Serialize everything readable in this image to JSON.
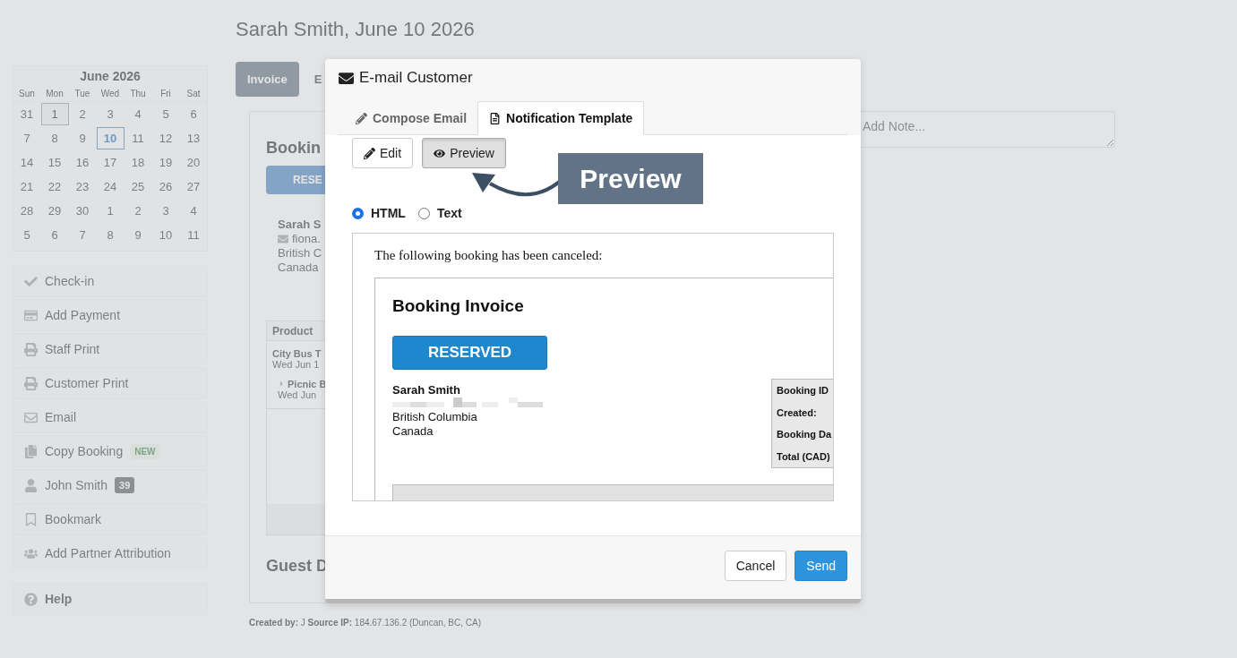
{
  "page": {
    "title": "Sarah Smith, June 10 2026"
  },
  "calendar": {
    "month": "June 2026",
    "weekdays": [
      "Sun",
      "Mon",
      "Tue",
      "Wed",
      "Thu",
      "Fri",
      "Sat"
    ],
    "days": [
      {
        "label": "31",
        "selected": false,
        "today": false
      },
      {
        "label": "1",
        "selected": false,
        "today": true
      },
      {
        "label": "2",
        "selected": false,
        "today": false
      },
      {
        "label": "3",
        "selected": false,
        "today": false
      },
      {
        "label": "4",
        "selected": false,
        "today": false
      },
      {
        "label": "5",
        "selected": false,
        "today": false
      },
      {
        "label": "6",
        "selected": false,
        "today": false
      },
      {
        "label": "7",
        "selected": false,
        "today": false
      },
      {
        "label": "8",
        "selected": false,
        "today": false
      },
      {
        "label": "9",
        "selected": false,
        "today": false
      },
      {
        "label": "10",
        "selected": true,
        "today": false
      },
      {
        "label": "11",
        "selected": false,
        "today": false
      },
      {
        "label": "12",
        "selected": false,
        "today": false
      },
      {
        "label": "13",
        "selected": false,
        "today": false
      },
      {
        "label": "14",
        "selected": false,
        "today": false
      },
      {
        "label": "15",
        "selected": false,
        "today": false
      },
      {
        "label": "16",
        "selected": false,
        "today": false
      },
      {
        "label": "17",
        "selected": false,
        "today": false
      },
      {
        "label": "18",
        "selected": false,
        "today": false
      },
      {
        "label": "19",
        "selected": false,
        "today": false
      },
      {
        "label": "20",
        "selected": false,
        "today": false
      },
      {
        "label": "21",
        "selected": false,
        "today": false
      },
      {
        "label": "22",
        "selected": false,
        "today": false
      },
      {
        "label": "23",
        "selected": false,
        "today": false
      },
      {
        "label": "24",
        "selected": false,
        "today": false
      },
      {
        "label": "25",
        "selected": false,
        "today": false
      },
      {
        "label": "26",
        "selected": false,
        "today": false
      },
      {
        "label": "27",
        "selected": false,
        "today": false
      },
      {
        "label": "28",
        "selected": false,
        "today": false
      },
      {
        "label": "29",
        "selected": false,
        "today": false
      },
      {
        "label": "30",
        "selected": false,
        "today": false
      },
      {
        "label": "1",
        "selected": false,
        "today": false
      },
      {
        "label": "2",
        "selected": false,
        "today": false
      },
      {
        "label": "3",
        "selected": false,
        "today": false
      },
      {
        "label": "4",
        "selected": false,
        "today": false
      },
      {
        "label": "5",
        "selected": false,
        "today": false
      },
      {
        "label": "6",
        "selected": false,
        "today": false
      },
      {
        "label": "7",
        "selected": false,
        "today": false
      },
      {
        "label": "8",
        "selected": false,
        "today": false
      },
      {
        "label": "9",
        "selected": false,
        "today": false
      },
      {
        "label": "10",
        "selected": false,
        "today": false
      },
      {
        "label": "11",
        "selected": false,
        "today": false
      }
    ]
  },
  "sidebar": {
    "items": [
      {
        "label": "Check-in"
      },
      {
        "label": "Add Payment"
      },
      {
        "label": "Staff Print"
      },
      {
        "label": "Customer Print"
      },
      {
        "label": "Email"
      },
      {
        "label": "Copy Booking",
        "badge": {
          "kind": "new",
          "text": "NEW"
        }
      },
      {
        "label": "John Smith",
        "badge": {
          "kind": "count",
          "text": "39"
        }
      },
      {
        "label": "Bookmark"
      },
      {
        "label": "Add Partner Attribution"
      }
    ],
    "help": "Help"
  },
  "view_tabs": [
    {
      "label": "Invoice",
      "selected": true
    },
    {
      "label": "E",
      "selected": false
    }
  ],
  "booking_card": {
    "heading": "Bookin",
    "status": "RESE",
    "customer": {
      "name": "Sarah S",
      "email": "fiona.",
      "region": "British C",
      "country": "Canada"
    },
    "table": {
      "columns": [
        "Product"
      ],
      "rows": [
        {
          "product": "City Bus T",
          "date": "Wed Jun 1",
          "children": [
            {
              "product": "Picnic B",
              "date": "Wed Jun"
            }
          ]
        }
      ]
    },
    "guest_heading": "Guest D"
  },
  "note_field": {
    "placeholder": "Add Note..."
  },
  "footer": "**Created by:** J **Source IP:** 184.67.136.2 (Duncan, BC, CA)",
  "modal": {
    "title": "E-mail Customer",
    "tabs": [
      {
        "label": "Compose Email",
        "selected": false
      },
      {
        "label": "Notification Template",
        "selected": true
      }
    ],
    "mode_buttons": [
      {
        "label": "Edit",
        "selected": false
      },
      {
        "label": "Preview",
        "selected": true
      }
    ],
    "callout": "Preview",
    "formats": [
      {
        "label": "HTML",
        "selected": true
      },
      {
        "label": "Text",
        "selected": false
      }
    ],
    "preview": {
      "intro": "The following booking has been canceled:",
      "heading": "Booking Invoice",
      "status": "RESERVED",
      "customer": {
        "name": "Sarah Smith",
        "region": "British Columbia",
        "country": "Canada"
      },
      "details": [
        "Booking ID",
        "Created:",
        "Booking Da",
        "Total (CAD)"
      ]
    },
    "buttons": [
      {
        "label": "Cancel",
        "kind": "secondary"
      },
      {
        "label": "Send",
        "kind": "primary"
      }
    ]
  }
}
